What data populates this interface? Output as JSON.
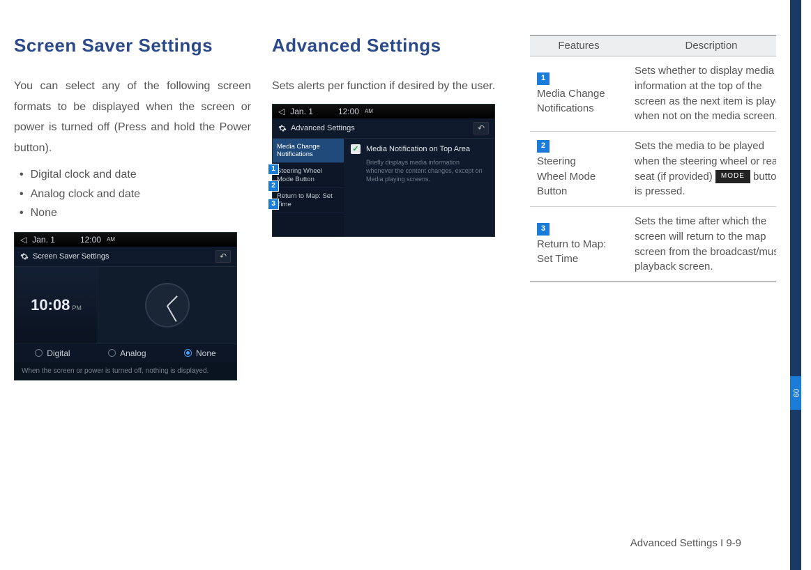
{
  "section1": {
    "title": "Screen Saver Settings",
    "intro": "You can select any of the following screen formats to be displayed when the screen or power is turned off (Press and hold the Power button).",
    "bullets": [
      "Digital clock and date",
      "Analog clock and date",
      "None"
    ]
  },
  "shot1": {
    "status_date": "Jan. 1",
    "status_time": "12:00",
    "status_ampm": "AM",
    "title": "Screen Saver Settings",
    "digital_time": "10:08",
    "digital_suffix": "PM",
    "opt_digital": "Digital",
    "opt_analog": "Analog",
    "opt_none": "None",
    "note": "When the screen or power is turned off, nothing is displayed."
  },
  "section2": {
    "title": "Advanced Settings",
    "intro": "Sets alerts per function if desired by the user."
  },
  "shot2": {
    "status_date": "Jan. 1",
    "status_time": "12:00",
    "status_ampm": "AM",
    "title": "Advanced Settings",
    "sidebar": [
      "Media Change Notifications",
      "Steering Wheel Mode Button",
      "Return to Map: Set Time"
    ],
    "check_label": "Media Notification on Top Area",
    "check_note": "Briefly displays media information whenever the content changes, except on Media playing screens."
  },
  "table": {
    "h_features": "Features",
    "h_desc": "Description",
    "rows": [
      {
        "num": "1",
        "label": "Media Change Notifications",
        "desc": "Sets whether to display media information at the top of the screen as the next item is played when not on the media screen."
      },
      {
        "num": "2",
        "label": "Steering Wheel Mode Button",
        "desc_pre": "Sets the media to be played when the steering wheel or rear seat (if provided) ",
        "mode": "MODE",
        "desc_post": " button is pressed."
      },
      {
        "num": "3",
        "label": "Return to Map: Set Time",
        "desc": "Sets the time after which the screen will return to the map screen from the broadcast/music playback screen."
      }
    ]
  },
  "footer": "Advanced Settings I 9-9",
  "sidetab": "09"
}
